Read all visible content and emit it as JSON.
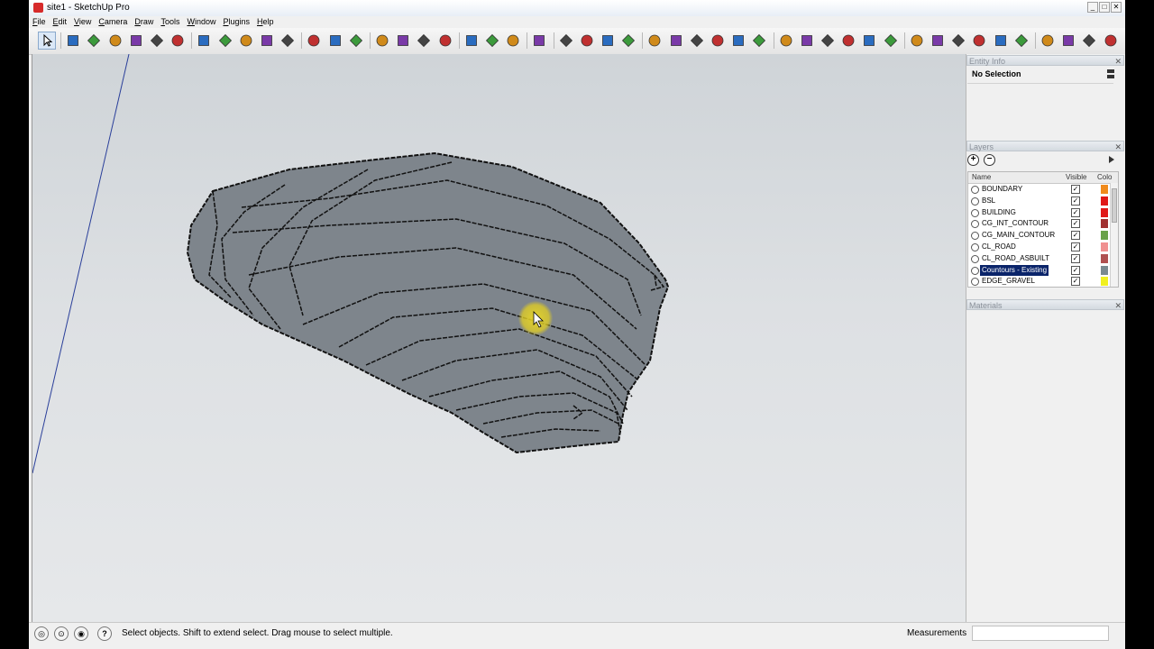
{
  "window": {
    "title": "site1 - SketchUp Pro"
  },
  "window_controls": [
    "_",
    "□",
    "✕"
  ],
  "menu": [
    "File",
    "Edit",
    "View",
    "Camera",
    "Draw",
    "Tools",
    "Window",
    "Plugins",
    "Help"
  ],
  "toolbar_icons": [
    "select-icon",
    "eraser-icon",
    "pencil-icon",
    "rectangle-icon",
    "circle-icon",
    "polygon-icon",
    "arc-icon",
    "pushpull-icon",
    "followme-icon",
    "move-icon",
    "rotate-icon",
    "scale-icon",
    "tape-icon",
    "text-icon",
    "protractor-icon",
    "orbit-icon",
    "pan-icon",
    "zoom-icon",
    "zoom-extents-icon",
    "section-icon",
    "walk-icon",
    "lookaround-icon",
    "previous-view-icon",
    "paint-icon",
    "axes-icon",
    "dimension-icon",
    "3dtext-icon",
    "layer-icon",
    "component-icon",
    "shadow-icon",
    "sun-icon",
    "fog-icon",
    "style-icon",
    "iso-icon",
    "top-icon",
    "front-icon",
    "right-icon",
    "back-icon",
    "left-icon",
    "xray-icon",
    "wireframe-icon",
    "hidden-icon",
    "shaded-icon",
    "texture-icon",
    "mono-icon",
    "ruby-icon",
    "plugin-icon",
    "export-icon",
    "import-icon",
    "warehouse-icon",
    "extension-icon"
  ],
  "entity_info": {
    "header": "Entity Info",
    "text": "No Selection"
  },
  "layers": {
    "header": "Layers",
    "columns": {
      "name": "Name",
      "visible": "Visible",
      "color": "Colo"
    },
    "rows": [
      {
        "name": "BOUNDARY",
        "visible": "✓",
        "color": "#f08a1c"
      },
      {
        "name": "BSL",
        "visible": "✓",
        "color": "#e01818"
      },
      {
        "name": "BUILDING",
        "visible": "✓",
        "color": "#e01818"
      },
      {
        "name": "CG_INT_CONTOUR",
        "visible": "✓",
        "color": "#a03030"
      },
      {
        "name": "CG_MAIN_CONTOUR",
        "visible": "✓",
        "color": "#6aa14a"
      },
      {
        "name": "CL_ROAD",
        "visible": "✓",
        "color": "#f09090"
      },
      {
        "name": "CL_ROAD_ASBUILT",
        "visible": "✓",
        "color": "#b05050"
      },
      {
        "name": "Countours - Existing",
        "visible": "✓",
        "color": "#7a8a90",
        "selected": true
      },
      {
        "name": "EDGE_GRAVEL",
        "visible": "✓",
        "color": "#f0f020"
      }
    ]
  },
  "materials": {
    "header": "Materials"
  },
  "status": {
    "text": "Select objects. Shift to extend select. Drag mouse to select multiple.",
    "measurements_label": "Measurements",
    "icons": [
      "geo-location-icon",
      "credits-icon",
      "sign-in-icon",
      "help-icon"
    ],
    "icon_glyphs": [
      "◎",
      "⊙",
      "◉",
      "?"
    ]
  },
  "colors": {
    "terrain": "#7e858c",
    "sky_top": "#cfd4d8",
    "selection": "#0a246a",
    "cursor_halo": "#e6d428"
  }
}
